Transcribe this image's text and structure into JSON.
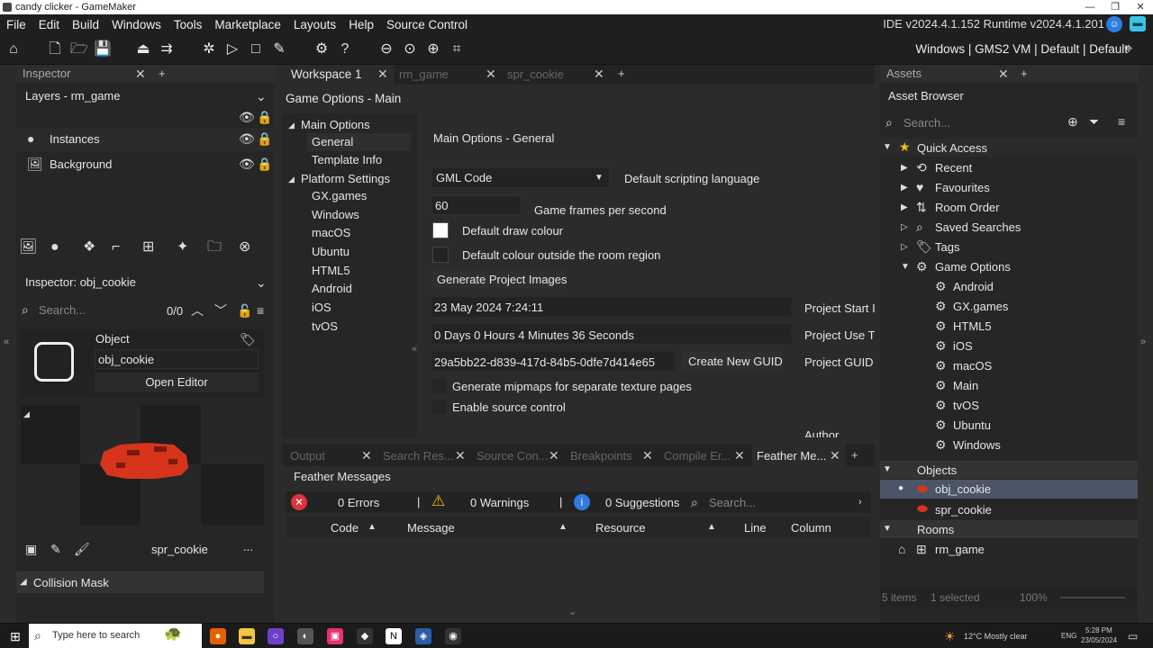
{
  "window": {
    "title": "candy clicker - GameMaker"
  },
  "menu": [
    "File",
    "Edit",
    "Build",
    "Windows",
    "Tools",
    "Marketplace",
    "Layouts",
    "Help",
    "Source Control"
  ],
  "version": "IDE v2024.4.1.152  Runtime v2024.4.1.201",
  "target": "Windows | GMS2 VM | Default | Default",
  "inspector": {
    "tab": "Inspector",
    "layers_title": "Layers - rm_game",
    "layers": [
      "Instances",
      "Background"
    ],
    "inspector_title": "Inspector: obj_cookie",
    "search_placeholder": "Search...",
    "count": "0/0",
    "object_label": "Object",
    "object_name": "obj_cookie",
    "open_editor": "Open Editor",
    "sprite_name": "spr_cookie",
    "more": "...",
    "collision_mask": "Collision Mask"
  },
  "workspace": {
    "tabs": [
      "Workspace 1",
      "rm_game",
      "spr_cookie"
    ],
    "panel_title": "Game Options - Main",
    "tree": {
      "main_options": "Main Options",
      "main_items": [
        "General",
        "Template Info"
      ],
      "platform_settings": "Platform Settings",
      "platform_items": [
        "GX.games",
        "Windows",
        "macOS",
        "Ubuntu",
        "HTML5",
        "Android",
        "iOS",
        "tvOS"
      ]
    },
    "general": {
      "title": "Main Options - General",
      "gml_code": "GML Code",
      "default_scripting": "Default scripting language",
      "fps_value": "60",
      "fps_label": "Game frames per second",
      "draw_colour": "Default draw colour",
      "outside_colour": "Default colour outside the room region",
      "generate_images": "Generate Project Images",
      "start_date": "23 May 2024 7:24:11",
      "project_start": "Project Start I",
      "use_time": "0 Days 0 Hours 4 Minutes 36 Seconds",
      "project_use": "Project Use T",
      "guid": "29a5bb22-d839-417d-84b5-0dfe7d414e65",
      "new_guid": "Create New GUID",
      "project_guid": "Project GUID",
      "mipmaps": "Generate mipmaps for separate texture pages",
      "source_control": "Enable source control",
      "author": "Author"
    }
  },
  "output": {
    "tabs": [
      "Output",
      "Search Res...",
      "Source Con...",
      "Breakpoints",
      "Compile Er...",
      "Feather Me..."
    ],
    "title": "Feather Messages",
    "errors": "0 Errors",
    "warnings": "0 Warnings",
    "suggestions": "0 Suggestions",
    "search_placeholder": "Search...",
    "columns": [
      "Code",
      "Message",
      "Resource",
      "Line",
      "Column"
    ]
  },
  "assets": {
    "tab": "Assets",
    "title": "Asset Browser",
    "search_placeholder": "Search...",
    "quick_access": "Quick Access",
    "quick_items": [
      "Recent",
      "Favourites",
      "Room Order",
      "Saved Searches",
      "Tags",
      "Game Options"
    ],
    "game_options": [
      "Android",
      "GX.games",
      "HTML5",
      "iOS",
      "macOS",
      "Main",
      "tvOS",
      "Ubuntu",
      "Windows"
    ],
    "objects": "Objects",
    "object_items": [
      "obj_cookie",
      "spr_cookie"
    ],
    "rooms": "Rooms",
    "room_items": [
      "rm_game"
    ],
    "status_items": "5 items",
    "status_selected": "1 selected",
    "zoom": "100%"
  },
  "taskbar": {
    "search_placeholder": "Type here to search",
    "weather": "12°C  Mostly clear",
    "lang": "ENG",
    "time": "5:28 PM",
    "date": "23/05/2024"
  },
  "colors": {
    "accent": "#4b5566",
    "error": "#e0323c",
    "warning": "#f2c200",
    "info": "#2f7be0"
  }
}
